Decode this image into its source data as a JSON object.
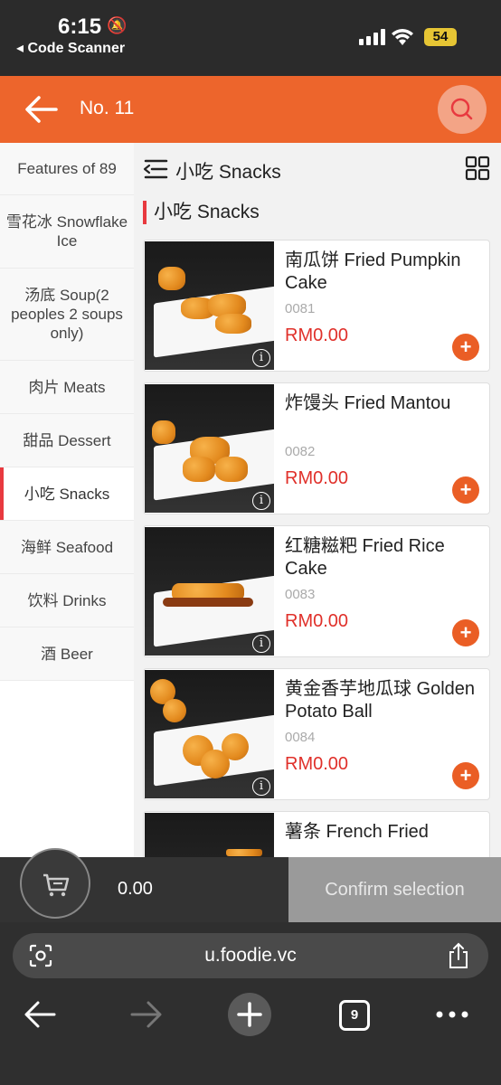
{
  "status_bar": {
    "time": "6:15",
    "back_app": "◂ Code Scanner",
    "battery": "54"
  },
  "header": {
    "title": "No. 11"
  },
  "sidebar": {
    "items": [
      {
        "label": "Features of 89",
        "active": false
      },
      {
        "label": "雪花冰 Snowflake Ice",
        "active": false
      },
      {
        "label": "汤底 Soup(2 peoples 2 soups only)",
        "active": false
      },
      {
        "label": "肉片 Meats",
        "active": false
      },
      {
        "label": "甜品 Dessert",
        "active": false
      },
      {
        "label": "小吃 Snacks",
        "active": true
      },
      {
        "label": "海鲜 Seafood",
        "active": false
      },
      {
        "label": "饮料 Drinks",
        "active": false
      },
      {
        "label": "酒 Beer",
        "active": false
      }
    ]
  },
  "main": {
    "category_title": "小吃 Snacks",
    "section_title": "小吃 Snacks",
    "products": [
      {
        "name": "南瓜饼 Fried Pumpkin Cake",
        "code": "0081",
        "price": "RM0.00",
        "add": "+"
      },
      {
        "name": "炸馒头 Fried Mantou",
        "code": "0082",
        "price": "RM0.00",
        "add": "+"
      },
      {
        "name": "红糖糍粑 Fried Rice Cake",
        "code": "0083",
        "price": "RM0.00",
        "add": "+"
      },
      {
        "name": "黄金香芋地瓜球 Golden Potato Ball",
        "code": "0084",
        "price": "RM0.00",
        "add": "+"
      },
      {
        "name": "薯条 French Fried",
        "code": "",
        "price": "",
        "add": ""
      }
    ]
  },
  "cart": {
    "total": "0.00",
    "confirm_label": "Confirm selection"
  },
  "browser": {
    "url": "u.foodie.vc",
    "tab_count": "9"
  },
  "colors": {
    "brand": "#ed652c",
    "accent_red": "#e8393f",
    "price": "#e0302a"
  }
}
